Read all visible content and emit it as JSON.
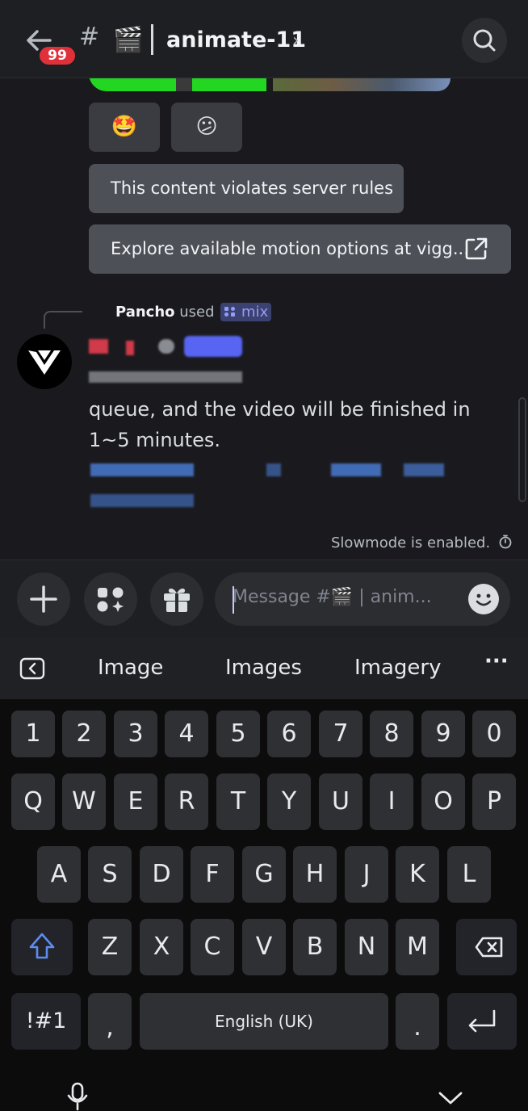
{
  "header": {
    "badge_count": "99",
    "hash": "#",
    "channel_emoji": "🎬",
    "channel_name": "animate-11",
    "chevron": "›",
    "icons": [
      "back-arrow-icon",
      "search-icon"
    ]
  },
  "reactions": [
    {
      "emoji": "🤩"
    },
    {
      "emoji": "😕"
    }
  ],
  "buttons": {
    "violation": "This content violates server rules",
    "explore": "Explore available motion options at vigg..."
  },
  "message": {
    "author": "Pancho",
    "used_label": "used",
    "command": "mix",
    "command_icon": "app-grid-icon",
    "text": "queue, and the video will be finished in 1~5 minutes."
  },
  "slowmode": {
    "text": "Slowmode is enabled.",
    "icon": "timer-icon"
  },
  "composer": {
    "placeholder": "Message #🎬 | anim...",
    "icons": [
      "plus-icon",
      "apps-icon",
      "gift-icon",
      "emoji-icon"
    ]
  },
  "keyboard": {
    "suggestions": [
      "Image",
      "Images",
      "Imagery"
    ],
    "more": "···",
    "row_numbers": [
      "1",
      "2",
      "3",
      "4",
      "5",
      "6",
      "7",
      "8",
      "9",
      "0"
    ],
    "row1": [
      "Q",
      "W",
      "E",
      "R",
      "T",
      "Y",
      "U",
      "I",
      "O",
      "P"
    ],
    "row2": [
      "A",
      "S",
      "D",
      "F",
      "G",
      "H",
      "J",
      "K",
      "L"
    ],
    "row3": [
      "Z",
      "X",
      "C",
      "V",
      "B",
      "N",
      "M"
    ],
    "symbols": "!#1",
    "comma": ",",
    "space": "English (UK)",
    "period": "."
  },
  "colors": {
    "accent_badge": "#e0313a",
    "command_tag": "#949cf7",
    "shift_active": "#5b8def"
  }
}
